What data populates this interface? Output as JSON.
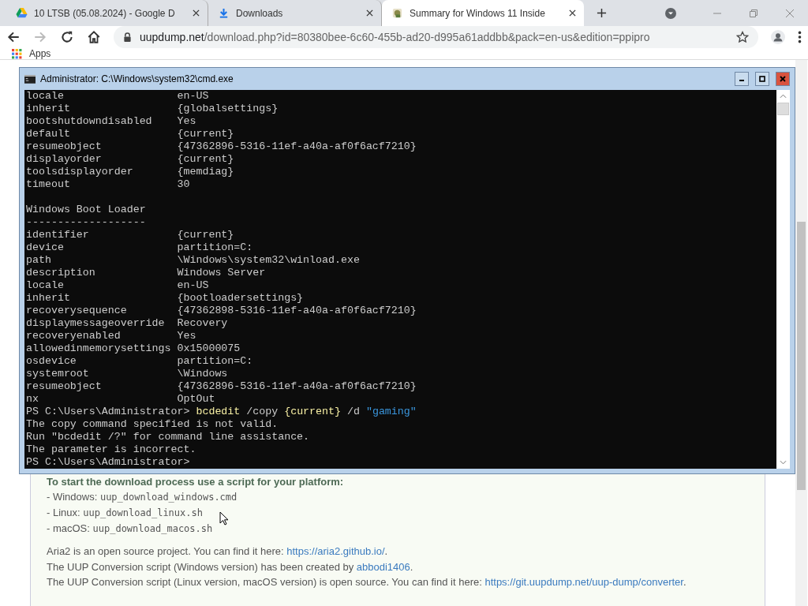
{
  "browser": {
    "tabs": [
      {
        "title": "10 LTSB (05.08.2024) - Google D",
        "selected": false
      },
      {
        "title": "Downloads",
        "selected": false
      },
      {
        "title": "Summary for Windows 11 Inside",
        "selected": true
      }
    ],
    "address": {
      "host": "uupdump.net",
      "path": "/download.php?id=80380bee-6c60-455b-ad20-d995a61addbb&pack=en-us&edition=ppipro"
    },
    "bookmarks": [
      {
        "label": "Apps"
      }
    ]
  },
  "console": {
    "title": "Administrator: C:\\Windows\\system32\\cmd.exe",
    "lines": [
      {
        "segments": [
          {
            "kind": "text",
            "text": "locale                  en-US"
          }
        ]
      },
      {
        "segments": [
          {
            "kind": "text",
            "text": "inherit                 {globalsettings}"
          }
        ]
      },
      {
        "segments": [
          {
            "kind": "text",
            "text": "bootshutdowndisabled    Yes"
          }
        ]
      },
      {
        "segments": [
          {
            "kind": "text",
            "text": "default                 {current}"
          }
        ]
      },
      {
        "segments": [
          {
            "kind": "text",
            "text": "resumeobject            {47362896-5316-11ef-a40a-af0f6acf7210}"
          }
        ]
      },
      {
        "segments": [
          {
            "kind": "text",
            "text": "displayorder            {current}"
          }
        ]
      },
      {
        "segments": [
          {
            "kind": "text",
            "text": "toolsdisplayorder       {memdiag}"
          }
        ]
      },
      {
        "segments": [
          {
            "kind": "text",
            "text": "timeout                 30"
          }
        ]
      },
      {
        "kind": "blank"
      },
      {
        "segments": [
          {
            "kind": "text",
            "text": "Windows Boot Loader"
          }
        ]
      },
      {
        "segments": [
          {
            "kind": "text",
            "text": "-------------------"
          }
        ]
      },
      {
        "segments": [
          {
            "kind": "text",
            "text": "identifier              {current}"
          }
        ]
      },
      {
        "segments": [
          {
            "kind": "text",
            "text": "device                  partition=C:"
          }
        ]
      },
      {
        "segments": [
          {
            "kind": "text",
            "text": "path                    \\Windows\\system32\\winload.exe"
          }
        ]
      },
      {
        "segments": [
          {
            "kind": "text",
            "text": "description             Windows Server"
          }
        ]
      },
      {
        "segments": [
          {
            "kind": "text",
            "text": "locale                  en-US"
          }
        ]
      },
      {
        "segments": [
          {
            "kind": "text",
            "text": "inherit                 {bootloadersettings}"
          }
        ]
      },
      {
        "segments": [
          {
            "kind": "text",
            "text": "recoverysequence        {47362898-5316-11ef-a40a-af0f6acf7210}"
          }
        ]
      },
      {
        "segments": [
          {
            "kind": "text",
            "text": "displaymessageoverride  Recovery"
          }
        ]
      },
      {
        "segments": [
          {
            "kind": "text",
            "text": "recoveryenabled         Yes"
          }
        ]
      },
      {
        "segments": [
          {
            "kind": "text",
            "text": "allowedinmemorysettings 0x15000075"
          }
        ]
      },
      {
        "segments": [
          {
            "kind": "text",
            "text": "osdevice                partition=C:"
          }
        ]
      },
      {
        "segments": [
          {
            "kind": "text",
            "text": "systemroot              \\Windows"
          }
        ]
      },
      {
        "segments": [
          {
            "kind": "text",
            "text": "resumeobject            {47362896-5316-11ef-a40a-af0f6acf7210}"
          }
        ]
      },
      {
        "segments": [
          {
            "kind": "text",
            "text": "nx                      OptOut"
          }
        ]
      },
      {
        "segments": [
          {
            "kind": "text",
            "text": "PS C:\\Users\\Administrator> "
          },
          {
            "kind": "command",
            "text": "bcdedit"
          },
          {
            "kind": "text",
            "text": " /copy "
          },
          {
            "kind": "command",
            "text": "{current}"
          },
          {
            "kind": "text",
            "text": " /d "
          },
          {
            "kind": "string",
            "text": "\"gaming\""
          }
        ]
      },
      {
        "segments": [
          {
            "kind": "text",
            "text": "The copy command specified is not valid."
          }
        ]
      },
      {
        "segments": [
          {
            "kind": "text",
            "text": "Run \"bcdedit /?\" for command line assistance."
          }
        ]
      },
      {
        "segments": [
          {
            "kind": "text",
            "text": "The parameter is incorrect."
          }
        ]
      },
      {
        "segments": [
          {
            "kind": "text",
            "text": "PS C:\\Users\\Administrator>"
          }
        ]
      }
    ]
  },
  "page": {
    "heading": "To start the download process use a script for your platform:",
    "scripts": [
      {
        "platform": "- Windows:",
        "file": "uup_download_windows.cmd"
      },
      {
        "platform": "- Linux:",
        "file": "uup_download_linux.sh"
      },
      {
        "platform": "- macOS:",
        "file": "uup_download_macos.sh"
      }
    ],
    "paragraphs": [
      {
        "text": "Aria2 is an open source project. You can find it here: ",
        "link": "https://aria2.github.io/",
        "after": "."
      },
      {
        "text": "The UUP Conversion script (Windows version) has been created by ",
        "link": "abbodi1406",
        "after": "."
      },
      {
        "text": "The UUP Conversion script (Linux version, macOS version) is open source. You can find it here: ",
        "link": "https://git.uupdump.net/uup-dump/converter",
        "after": "."
      }
    ]
  }
}
